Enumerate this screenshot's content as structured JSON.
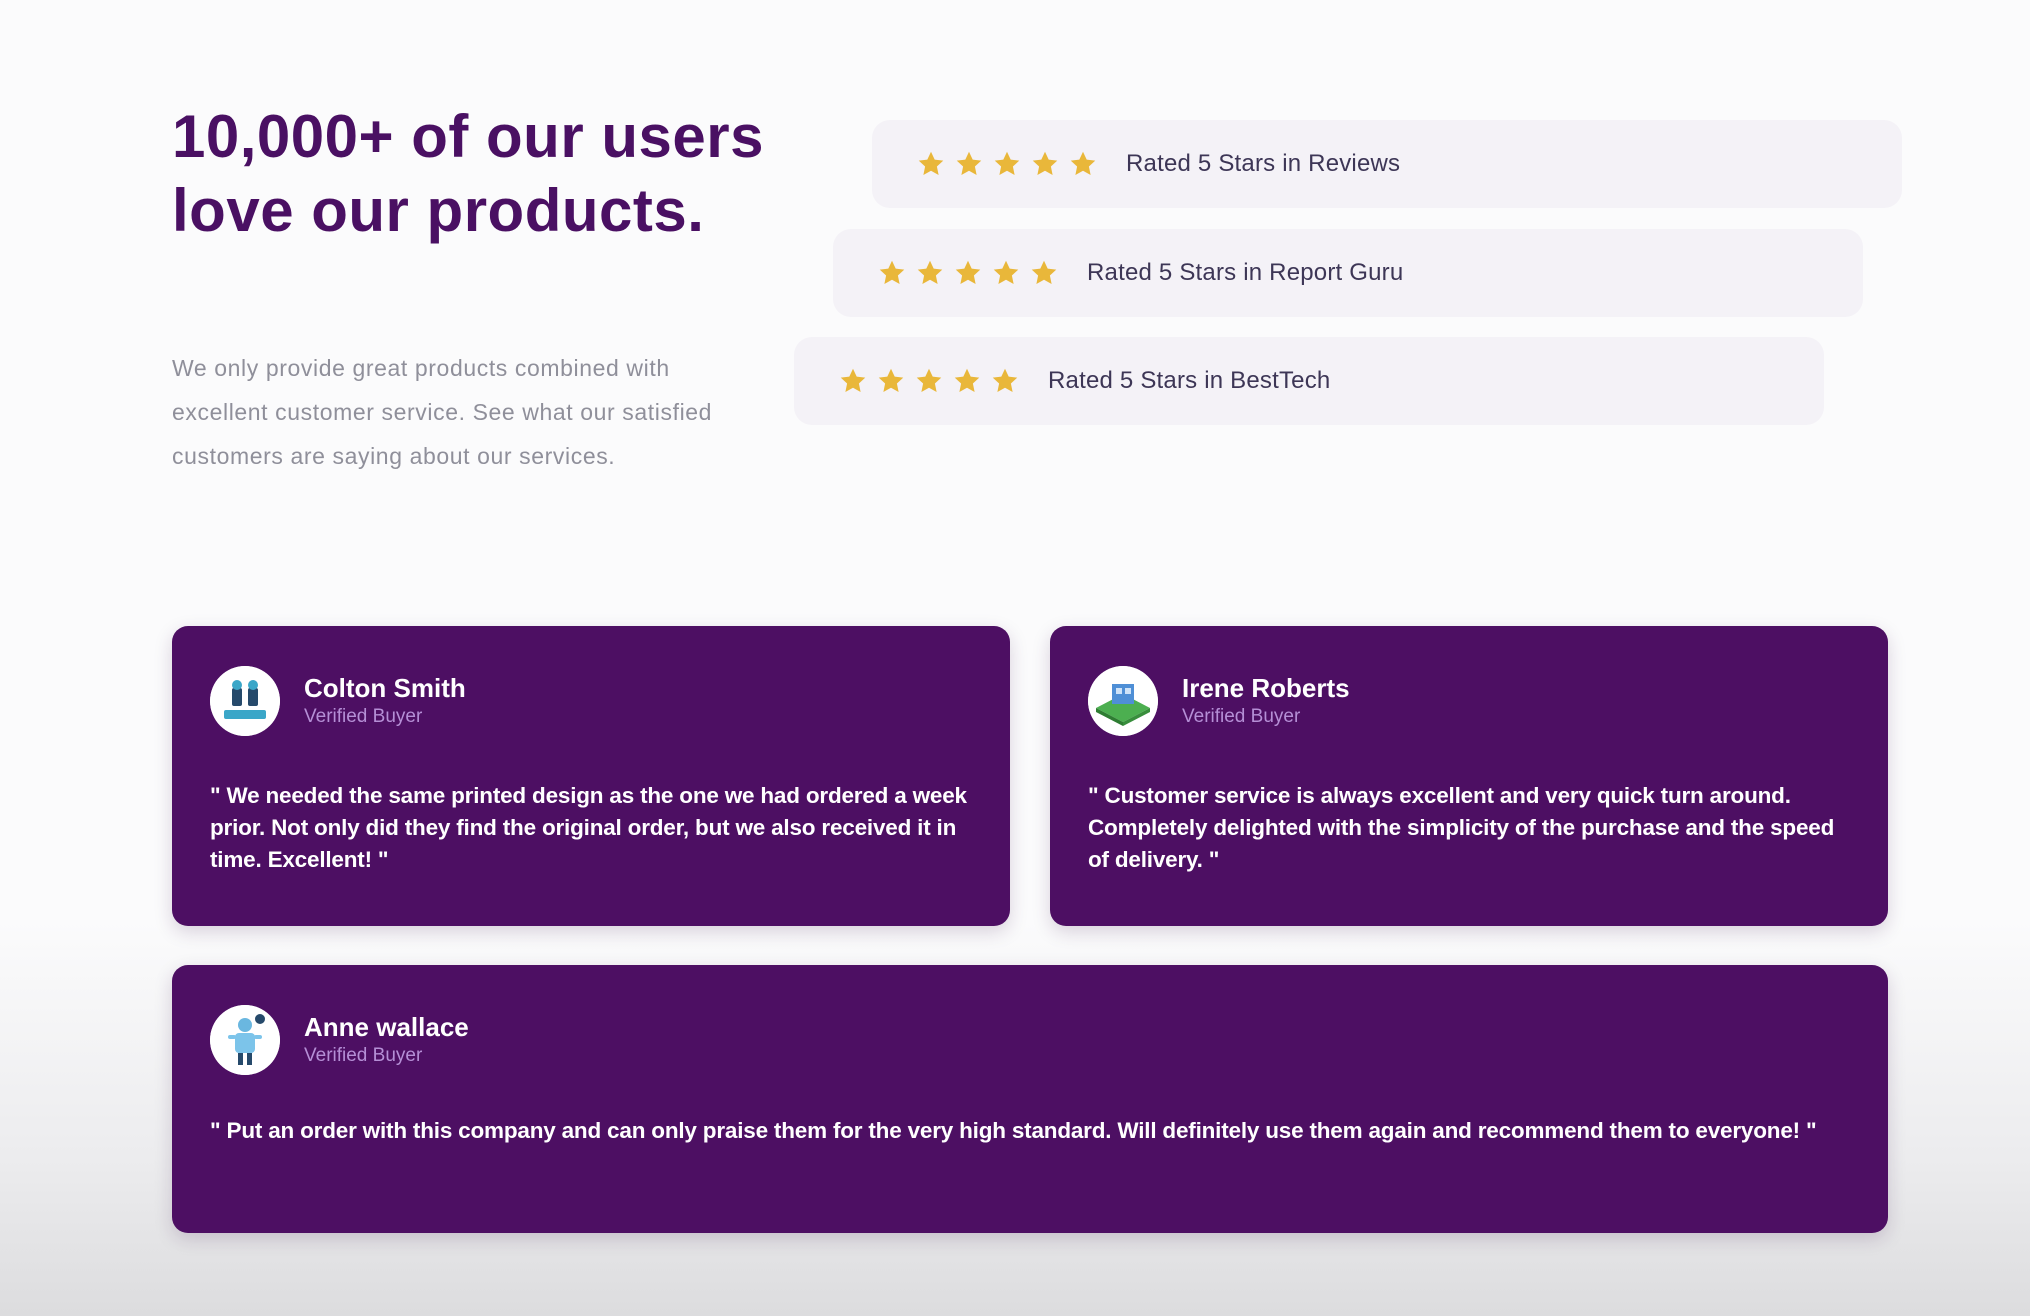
{
  "hero": {
    "title": "10,000+ of our users love our products.",
    "description": "We only provide great products combined with excellent customer service. See what our satisfied customers are saying about our services."
  },
  "ratings": [
    {
      "stars": 5,
      "label": "Rated 5 Stars in Reviews"
    },
    {
      "stars": 5,
      "label": "Rated 5 Stars in Report Guru"
    },
    {
      "stars": 5,
      "label": "Rated 5 Stars in BestTech"
    }
  ],
  "testimonials": [
    {
      "name": "Colton Smith",
      "badge": "Verified Buyer",
      "quote": "\" We needed the same printed design as the one we had ordered a week prior. Not only did they find the original order, but we also received it in time. Excellent! \""
    },
    {
      "name": "Irene Roberts",
      "badge": "Verified Buyer",
      "quote": "\" Customer service is always excellent and very quick turn around. Completely delighted with the simplicity of the purchase and the speed of delivery. \""
    },
    {
      "name": "Anne wallace",
      "badge": "Verified Buyer",
      "quote": "\" Put an order with this company and can only praise them for the very high standard. Will definitely use them again and recommend them to everyone! \""
    }
  ],
  "colors": {
    "brand_purple": "#4d0f63",
    "title_purple": "#4a1063",
    "star_gold": "#e9b73a",
    "pill_bg": "#f4f2f7"
  }
}
